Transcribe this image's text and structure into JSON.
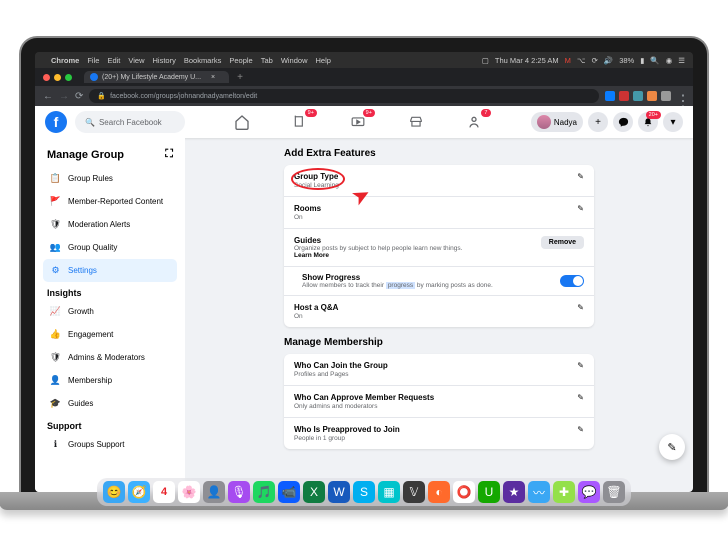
{
  "menubar": {
    "app": "Chrome",
    "items": [
      "File",
      "Edit",
      "View",
      "History",
      "Bookmarks",
      "People",
      "Tab",
      "Window",
      "Help"
    ],
    "time": "Thu Mar 4 2:25 AM",
    "battery": "38%"
  },
  "browser": {
    "tab_title": "(20+) My Lifestyle Academy U...",
    "url": "facebook.com/groups/johnandnadyamelton/edit"
  },
  "fb": {
    "search_placeholder": "Search Facebook",
    "user_name": "Nadya",
    "badges": {
      "nav1": "9+",
      "nav2": "9+",
      "notif": "7",
      "bell": "20+"
    }
  },
  "sidebar": {
    "title": "Manage Group",
    "groups": [
      {
        "head": "",
        "items": [
          {
            "label": "Group Rules",
            "icon": "📋"
          },
          {
            "label": "Member-Reported Content",
            "icon": "🚩"
          },
          {
            "label": "Moderation Alerts",
            "icon": "🛡"
          },
          {
            "label": "Group Quality",
            "icon": "👥"
          },
          {
            "label": "Settings",
            "icon": "⚙",
            "active": true
          }
        ]
      },
      {
        "head": "Insights",
        "items": [
          {
            "label": "Growth",
            "icon": "📈"
          },
          {
            "label": "Engagement",
            "icon": "👍"
          },
          {
            "label": "Admins & Moderators",
            "icon": "🛡"
          },
          {
            "label": "Membership",
            "icon": "👤"
          },
          {
            "label": "Guides",
            "icon": "🎓"
          }
        ]
      },
      {
        "head": "Support",
        "items": [
          {
            "label": "Groups Support",
            "icon": "ℹ"
          }
        ]
      }
    ]
  },
  "sections": {
    "extra": {
      "title": "Add Extra Features",
      "group_type": {
        "title": "Group Type",
        "sub": "Social Learning"
      },
      "rooms": {
        "title": "Rooms",
        "sub": "On"
      },
      "guides": {
        "title": "Guides",
        "sub": "Organize posts by subject to help people learn new things.",
        "learn": "Learn More",
        "remove": "Remove"
      },
      "progress": {
        "title": "Show Progress",
        "sub_a": "Allow members to track their ",
        "sub_hl": "progress",
        "sub_b": " by marking posts as done."
      },
      "qa": {
        "title": "Host a Q&A",
        "sub": "On"
      }
    },
    "membership": {
      "title": "Manage Membership",
      "join": {
        "title": "Who Can Join the Group",
        "sub": "Profiles and Pages"
      },
      "approve": {
        "title": "Who Can Approve Member Requests",
        "sub": "Only admins and moderators"
      },
      "pre": {
        "title": "Who Is Preapproved to Join",
        "sub": "People in 1 group"
      }
    }
  },
  "dock": [
    {
      "name": "finder",
      "c": "#3aa7f4",
      "g": "😊"
    },
    {
      "name": "safari",
      "c": "#3db1ff",
      "g": "🧭"
    },
    {
      "name": "calendar",
      "c": "#fff",
      "g": "4"
    },
    {
      "name": "photos",
      "c": "#fff",
      "g": "🌸"
    },
    {
      "name": "contacts",
      "c": "#8e8e93",
      "g": "👤"
    },
    {
      "name": "podcasts",
      "c": "#a64cf0",
      "g": "🎙"
    },
    {
      "name": "spotify",
      "c": "#1ed760",
      "g": "🎵"
    },
    {
      "name": "zoom",
      "c": "#0b5cff",
      "g": "📹"
    },
    {
      "name": "excel",
      "c": "#107c41",
      "g": "X"
    },
    {
      "name": "word",
      "c": "#185abd",
      "g": "W"
    },
    {
      "name": "skype",
      "c": "#00aff0",
      "g": "S"
    },
    {
      "name": "canva",
      "c": "#00c4cc",
      "g": "▦"
    },
    {
      "name": "streamyard",
      "c": "#3a3a3a",
      "g": "𝕍"
    },
    {
      "name": "cleanmymac",
      "c": "#ff6a2b",
      "g": "◐"
    },
    {
      "name": "chrome",
      "c": "#fff",
      "g": "⭕"
    },
    {
      "name": "upwork",
      "c": "#14a800",
      "g": "U"
    },
    {
      "name": "imovie",
      "c": "#5b2da0",
      "g": "★"
    },
    {
      "name": "wave",
      "c": "#3aa7f4",
      "g": "〰"
    },
    {
      "name": "exp",
      "c": "#94e04a",
      "g": "✚"
    },
    {
      "name": "messenger",
      "c": "#a958ff",
      "g": "💬"
    },
    {
      "name": "trash",
      "c": "#8e8e93",
      "g": "🗑"
    }
  ]
}
